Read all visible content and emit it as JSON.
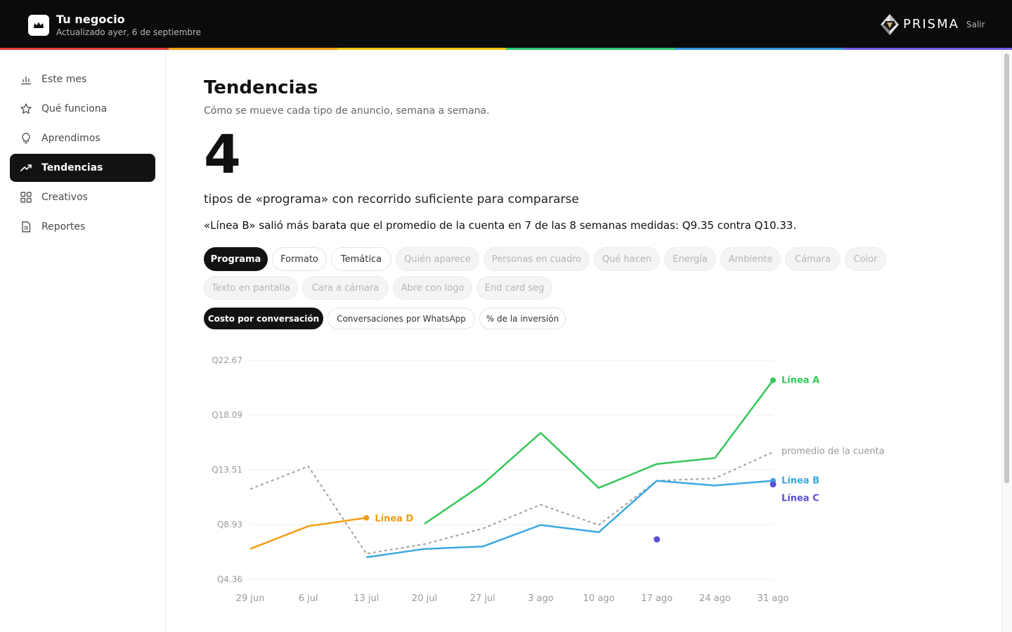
{
  "header": {
    "title": "Tu negocio",
    "subtitle": "Actualizado ayer, 6 de septiembre",
    "brand": "PRISMA",
    "logout": "Salir",
    "rainbow_colors": [
      "#e53935",
      "#f39c12",
      "#f1c40f",
      "#2ecc71",
      "#3498db",
      "#6c5ce7"
    ]
  },
  "sidebar": {
    "items": [
      {
        "label": "Este mes",
        "icon": "bar-chart-icon",
        "active": false
      },
      {
        "label": "Qué funciona",
        "icon": "star-icon",
        "active": false
      },
      {
        "label": "Aprendimos",
        "icon": "lightbulb-icon",
        "active": false
      },
      {
        "label": "Tendencias",
        "icon": "trend-icon",
        "active": true
      },
      {
        "label": "Creativos",
        "icon": "grid-icon",
        "active": false
      },
      {
        "label": "Reportes",
        "icon": "document-icon",
        "active": false
      }
    ]
  },
  "main": {
    "title": "Tendencias",
    "subtitle": "Cómo se mueve cada tipo de anuncio, semana a semana.",
    "big_number": "4",
    "big_caption": "tipos de «programa» con recorrido suficiente para compararse",
    "insight": "«Línea B» salió más barata que el promedio de la cuenta en 7 de las 8 semanas medidas: Q9.35 contra Q10.33."
  },
  "dimension_chips": [
    {
      "label": "Programa",
      "state": "active"
    },
    {
      "label": "Formato",
      "state": "enabled"
    },
    {
      "label": "Temática",
      "state": "enabled"
    },
    {
      "label": "Quién aparece",
      "state": "disabled"
    },
    {
      "label": "Personas en cuadro",
      "state": "disabled"
    },
    {
      "label": "Qué hacen",
      "state": "disabled"
    },
    {
      "label": "Energía",
      "state": "disabled"
    },
    {
      "label": "Ambiente",
      "state": "disabled"
    },
    {
      "label": "Cámara",
      "state": "disabled"
    },
    {
      "label": "Color",
      "state": "disabled"
    },
    {
      "label": "Texto en pantalla",
      "state": "disabled"
    },
    {
      "label": "Cara a cámara",
      "state": "disabled"
    },
    {
      "label": "Abre con logo",
      "state": "disabled"
    },
    {
      "label": "End card seg",
      "state": "disabled"
    }
  ],
  "metric_chips": [
    {
      "label": "Costo por conversación",
      "state": "active"
    },
    {
      "label": "Conversaciones por WhatsApp",
      "state": "enabled"
    },
    {
      "label": "% de la inversión",
      "state": "enabled"
    }
  ],
  "chart_data": {
    "type": "line",
    "x": [
      "29 jun",
      "6 jul",
      "13 jul",
      "20 jul",
      "27 jul",
      "3 ago",
      "10 ago",
      "17 ago",
      "24 ago",
      "31 ago"
    ],
    "ylim": [
      4.36,
      22.67
    ],
    "yticks": [
      "Q22.67",
      "Q18.09",
      "Q13.51",
      "Q8.93",
      "Q4.36"
    ],
    "grid": true,
    "series": [
      {
        "name": "Línea A",
        "color": "#34c759",
        "dashed": false,
        "end_marker": true,
        "values": [
          null,
          null,
          null,
          9.0,
          12.3,
          16.6,
          12.0,
          14.0,
          14.5,
          21.0
        ]
      },
      {
        "name": "Línea B",
        "color": "#3aa8e0",
        "dashed": false,
        "end_marker": true,
        "values": [
          null,
          null,
          6.2,
          6.9,
          7.1,
          8.9,
          8.3,
          12.6,
          12.2,
          12.6
        ]
      },
      {
        "name": "Línea C",
        "color": "#5b4fd6",
        "dashed": false,
        "end_marker": false,
        "values": [
          null,
          null,
          null,
          null,
          null,
          null,
          null,
          7.7,
          null,
          12.3
        ]
      },
      {
        "name": "Línea D",
        "color": "#f39c12",
        "dashed": false,
        "end_marker": true,
        "values": [
          6.9,
          8.8,
          9.5,
          null,
          null,
          null,
          null,
          null,
          null,
          null
        ]
      },
      {
        "name": "promedio de la cuenta",
        "color": "#a0a0a0",
        "dashed": true,
        "end_marker": false,
        "values": [
          11.9,
          13.8,
          6.5,
          7.3,
          8.6,
          10.6,
          8.9,
          12.6,
          12.8,
          15.0
        ]
      }
    ]
  }
}
